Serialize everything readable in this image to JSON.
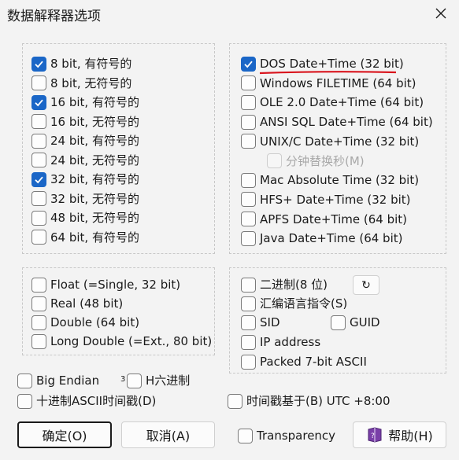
{
  "window": {
    "title": "数据解释器选项"
  },
  "integers": [
    {
      "label": "8 bit, 有符号的",
      "checked": true
    },
    {
      "label": "8 bit, 无符号的",
      "checked": false
    },
    {
      "label": "16 bit, 有符号的",
      "checked": true
    },
    {
      "label": "16 bit, 无符号的",
      "checked": false
    },
    {
      "label": "24 bit, 有符号的",
      "checked": false
    },
    {
      "label": "24 bit, 无符号的",
      "checked": false
    },
    {
      "label": "32 bit, 有符号的",
      "checked": true
    },
    {
      "label": "32 bit, 无符号的",
      "checked": false
    },
    {
      "label": "48 bit, 无符号的",
      "checked": false
    },
    {
      "label": "64 bit, 有符号的",
      "checked": false
    }
  ],
  "dates": [
    {
      "label": "DOS Date+Time (32 bit)",
      "checked": true
    },
    {
      "label": "Windows FILETIME (64 bit)",
      "checked": false
    },
    {
      "label": "OLE 2.0 Date+Time (64 bit)",
      "checked": false
    },
    {
      "label": "ANSI SQL Date+Time (64 bit)",
      "checked": false
    },
    {
      "label": "UNIX/C Date+Time (32 bit)",
      "checked": false
    },
    {
      "label": "分钟替换秒(M)",
      "checked": false,
      "disabled": true
    },
    {
      "label": "Mac Absolute Time (32 bit)",
      "checked": false
    },
    {
      "label": "HFS+ Date+Time (32 bit)",
      "checked": false
    },
    {
      "label": "APFS Date+Time (64 bit)",
      "checked": false
    },
    {
      "label": "Java Date+Time (64 bit)",
      "checked": false
    }
  ],
  "floats": [
    {
      "label": "Float (=Single, 32 bit)",
      "checked": false
    },
    {
      "label": "Real (48 bit)",
      "checked": false
    },
    {
      "label": "Double (64 bit)",
      "checked": false
    },
    {
      "label": "Long Double (=Ext., 80 bit)",
      "checked": false
    }
  ],
  "misc": {
    "binary": "二进制(8 位)",
    "assembly": "汇编语言指令(S)",
    "sid": "SID",
    "guid": "GUID",
    "ip": "IP address",
    "packed": "Packed 7-bit ASCII",
    "refresh_glyph": "↻"
  },
  "bottom": {
    "big_endian": "Big Endian",
    "small_3": "3",
    "hex": "H六进制",
    "decimal_ascii": "十进制ASCII时间戳(D)",
    "timestamp_base": "时间戳基于(B) UTC +8:00",
    "transparency": "Transparency"
  },
  "buttons": {
    "ok": "确定(O)",
    "cancel": "取消(A)",
    "help": "帮助(H)"
  },
  "colors": {
    "accent": "#1a66c7",
    "underline": "#d9141d"
  }
}
